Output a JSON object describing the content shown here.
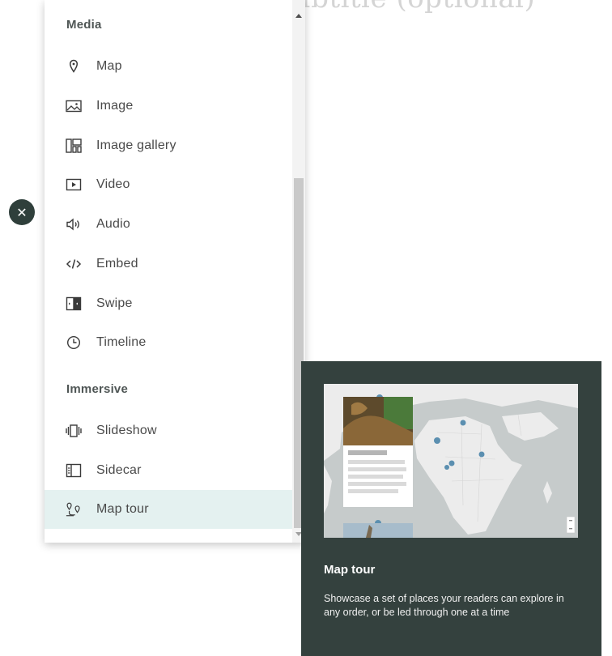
{
  "background": {
    "heading_text": "Introduction of Subtitle (optional)"
  },
  "close_button": {
    "icon": "close-icon",
    "glyph": "✕"
  },
  "menu": {
    "sections": [
      {
        "title": "Media"
      },
      {
        "title": "Immersive"
      }
    ],
    "items": [
      {
        "label": "Map",
        "icon": "map-pin-icon"
      },
      {
        "label": "Image",
        "icon": "image-icon"
      },
      {
        "label": "Image gallery",
        "icon": "image-gallery-icon"
      },
      {
        "label": "Video",
        "icon": "video-icon"
      },
      {
        "label": "Audio",
        "icon": "audio-icon"
      },
      {
        "label": "Embed",
        "icon": "embed-icon"
      },
      {
        "label": "Swipe",
        "icon": "swipe-icon"
      },
      {
        "label": "Timeline",
        "icon": "clock-icon"
      },
      {
        "label": "Slideshow",
        "icon": "slideshow-icon"
      },
      {
        "label": "Sidecar",
        "icon": "sidecar-icon"
      },
      {
        "label": "Map tour",
        "icon": "map-tour-icon",
        "selected": true
      }
    ]
  },
  "preview": {
    "title": "Map tour",
    "description": "Showcase a set of places your readers can explore in any order, or be led through one at a time",
    "image": "map-tour-preview-image"
  },
  "colors": {
    "accent_dark": "#34413e",
    "selected_bg": "#e4f1f0"
  }
}
